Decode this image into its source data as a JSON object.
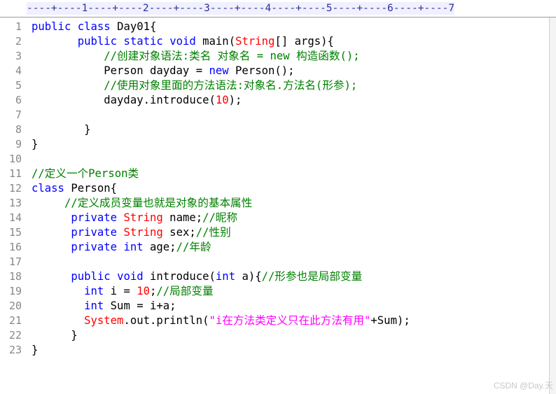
{
  "editor": {
    "ruler": "----+----1----+----2----+----3----+----4----+----5----+----6----+----7",
    "colors": {
      "keyword": "#0000ff",
      "type": "#ff0000",
      "comment": "#008000",
      "string": "#ff00ff",
      "line_number": "#888888"
    },
    "line_numbers": [
      "1",
      "2",
      "3",
      "4",
      "5",
      "6",
      "7",
      "8",
      "9",
      "10",
      "11",
      "12",
      "13",
      "14",
      "15",
      "16",
      "17",
      "18",
      "19",
      "20",
      "21",
      "22",
      "23"
    ],
    "lines": [
      [
        {
          "t": "kw",
          "v": "public"
        },
        {
          "t": "tx",
          "v": " "
        },
        {
          "t": "kw",
          "v": "class"
        },
        {
          "t": "tx",
          "v": " Day01{"
        }
      ],
      [
        {
          "t": "tx",
          "v": "       "
        },
        {
          "t": "kw",
          "v": "public"
        },
        {
          "t": "tx",
          "v": " "
        },
        {
          "t": "kw",
          "v": "static"
        },
        {
          "t": "tx",
          "v": " "
        },
        {
          "t": "kw",
          "v": "void"
        },
        {
          "t": "tx",
          "v": " main("
        },
        {
          "t": "ty",
          "v": "String"
        },
        {
          "t": "tx",
          "v": "[] args){"
        }
      ],
      [
        {
          "t": "tx",
          "v": "           "
        },
        {
          "t": "cm",
          "v": "//创建对象语法:类名 对象名 = new 构造函数();"
        }
      ],
      [
        {
          "t": "tx",
          "v": "           Person dayday = "
        },
        {
          "t": "kw",
          "v": "new"
        },
        {
          "t": "tx",
          "v": " Person();"
        }
      ],
      [
        {
          "t": "tx",
          "v": "           "
        },
        {
          "t": "cm",
          "v": "//使用对象里面的方法语法:对象名.方法名(形参);"
        }
      ],
      [
        {
          "t": "tx",
          "v": "           dayday.introduce("
        },
        {
          "t": "nm",
          "v": "10"
        },
        {
          "t": "tx",
          "v": ");"
        }
      ],
      [],
      [
        {
          "t": "tx",
          "v": "        }"
        }
      ],
      [
        {
          "t": "tx",
          "v": "}"
        }
      ],
      [],
      [
        {
          "t": "cm",
          "v": "//定义一个Person类"
        }
      ],
      [
        {
          "t": "kw",
          "v": "class"
        },
        {
          "t": "tx",
          "v": " Person{"
        }
      ],
      [
        {
          "t": "tx",
          "v": "     "
        },
        {
          "t": "cm",
          "v": "//定义成员变量也就是对象的基本属性"
        }
      ],
      [
        {
          "t": "tx",
          "v": "      "
        },
        {
          "t": "kw",
          "v": "private"
        },
        {
          "t": "tx",
          "v": " "
        },
        {
          "t": "ty",
          "v": "String"
        },
        {
          "t": "tx",
          "v": " name;"
        },
        {
          "t": "cm",
          "v": "//昵称"
        }
      ],
      [
        {
          "t": "tx",
          "v": "      "
        },
        {
          "t": "kw",
          "v": "private"
        },
        {
          "t": "tx",
          "v": " "
        },
        {
          "t": "ty",
          "v": "String"
        },
        {
          "t": "tx",
          "v": " sex;"
        },
        {
          "t": "cm",
          "v": "//性别"
        }
      ],
      [
        {
          "t": "tx",
          "v": "      "
        },
        {
          "t": "kw",
          "v": "private"
        },
        {
          "t": "tx",
          "v": " "
        },
        {
          "t": "kw",
          "v": "int"
        },
        {
          "t": "tx",
          "v": " age;"
        },
        {
          "t": "cm",
          "v": "//年龄"
        }
      ],
      [],
      [
        {
          "t": "tx",
          "v": "      "
        },
        {
          "t": "kw",
          "v": "public"
        },
        {
          "t": "tx",
          "v": " "
        },
        {
          "t": "kw",
          "v": "void"
        },
        {
          "t": "tx",
          "v": " introduce("
        },
        {
          "t": "kw",
          "v": "int"
        },
        {
          "t": "tx",
          "v": " a){"
        },
        {
          "t": "cm",
          "v": "//形参也是局部变量"
        }
      ],
      [
        {
          "t": "tx",
          "v": "        "
        },
        {
          "t": "kw",
          "v": "int"
        },
        {
          "t": "tx",
          "v": " i = "
        },
        {
          "t": "nm",
          "v": "10"
        },
        {
          "t": "tx",
          "v": ";"
        },
        {
          "t": "cm",
          "v": "//局部变量"
        }
      ],
      [
        {
          "t": "tx",
          "v": "        "
        },
        {
          "t": "kw",
          "v": "int"
        },
        {
          "t": "tx",
          "v": " Sum = i+a;"
        }
      ],
      [
        {
          "t": "tx",
          "v": "        "
        },
        {
          "t": "ty",
          "v": "System"
        },
        {
          "t": "tx",
          "v": ".out.println("
        },
        {
          "t": "st",
          "v": "\"i在方法类定义只在此方法有用\""
        },
        {
          "t": "tx",
          "v": "+Sum);"
        }
      ],
      [
        {
          "t": "tx",
          "v": "      }"
        }
      ],
      [
        {
          "t": "tx",
          "v": "}"
        }
      ]
    ]
  },
  "watermark": "CSDN @Day.天"
}
